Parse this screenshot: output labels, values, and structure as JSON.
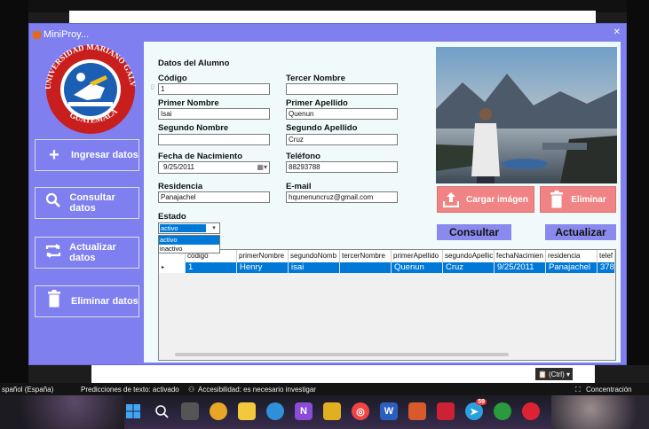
{
  "window": {
    "title": "MiniProy..."
  },
  "logo": {
    "arc_text_top": "UNIVERSIDAD MARIANO GALVEZ",
    "arc_text_bottom": "GUATEMALA"
  },
  "sidebar": {
    "items": [
      {
        "label": "Ingresar datos",
        "icon": "plus-icon"
      },
      {
        "label": "Consultar datos",
        "icon": "search-icon"
      },
      {
        "label": "Actualizar datos",
        "icon": "refresh-icon"
      },
      {
        "label": "Eliminar datos",
        "icon": "trash-icon"
      }
    ]
  },
  "form": {
    "section_title": "Datos del Alumno",
    "codigo": {
      "label": "Código",
      "value": "1"
    },
    "tercer_nombre": {
      "label": "Tercer Nombre",
      "value": ""
    },
    "primer_nombre": {
      "label": "Primer Nombre",
      "value": "Isai"
    },
    "primer_apellido": {
      "label": "Primer Apellido",
      "value": "Quenun"
    },
    "segundo_nombre": {
      "label": "Segundo Nombre",
      "value": ""
    },
    "segundo_apellido": {
      "label": "Segundo Apellido",
      "value": "Cruz"
    },
    "fecha_nacimiento": {
      "label": "Fecha de Nacimiento",
      "value": "9/25/2011"
    },
    "telefono": {
      "label": "Teléfono",
      "value": "88293788"
    },
    "residencia": {
      "label": "Residencia",
      "value": "Panajachel"
    },
    "email": {
      "label": "E-mail",
      "value": "hqunenuncruz@gmail.com"
    },
    "estado": {
      "label": "Estado",
      "value": "activo",
      "options": [
        "activo",
        "inactivo"
      ]
    }
  },
  "buttons": {
    "cargar_imagen": "Cargar imágen",
    "eliminar": "Eliminar",
    "consultar": "Consultar",
    "actualizar": "Actualizar"
  },
  "grid": {
    "columns": [
      "codigo",
      "primerNombre",
      "segundoNomb",
      "tercerNombre",
      "primerApellido",
      "segundoApellic",
      "fechaNacimien",
      "residencia",
      "telef"
    ],
    "rows": [
      [
        "1",
        "Henry",
        "isai",
        "",
        "Quenun",
        "Cruz",
        "9/25/2011",
        "Panajachel",
        "3782"
      ]
    ]
  },
  "paste_tip": "(Ctrl) ▾",
  "statusbar": {
    "language": "spañol (España)",
    "text_prediction": "Predicciones de texto: activado",
    "accessibility": "Accesibilidad: es necesario investigar",
    "focus": "Concentración"
  },
  "taskbar": {
    "icons": [
      "windows-start-icon",
      "search-icon",
      "task-view-icon",
      "paint-icon",
      "file-explorer-icon",
      "edge-icon",
      "visual-studio-icon",
      "photos-icon",
      "chrome-icon",
      "word-icon",
      "app-icon",
      "camera-icon",
      "telegram-icon",
      "xbox-icon",
      "security-icon"
    ],
    "telegram_badge": "59"
  }
}
